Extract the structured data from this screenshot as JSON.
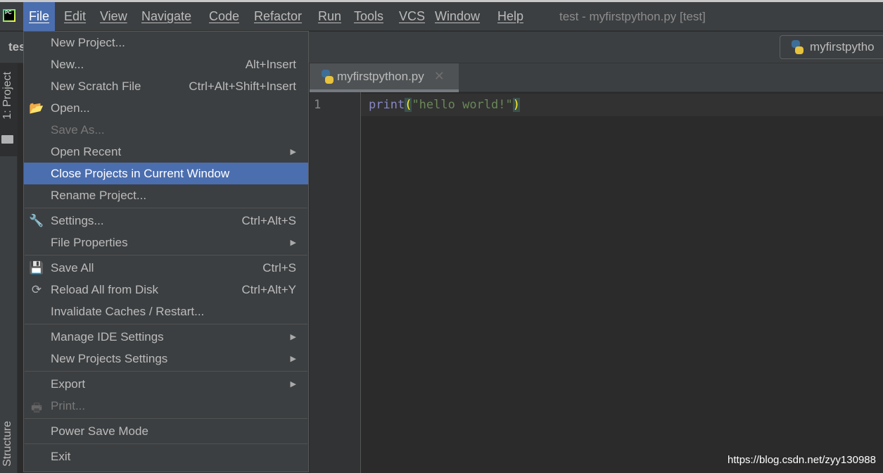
{
  "menubar": {
    "items": [
      "File",
      "Edit",
      "View",
      "Navigate",
      "Code",
      "Refactor",
      "Run",
      "Tools",
      "VCS",
      "Window",
      "Help"
    ],
    "active": "File"
  },
  "window_title": "test - myfirstpython.py [test]",
  "toolbar": {
    "project_name": "tes",
    "run_config": "myfirstpytho"
  },
  "left_panel": {
    "project_tab": "1: Project",
    "structure_tab": "Structure"
  },
  "editor": {
    "tab": "myfirstpython.py",
    "line_number": "1",
    "code": {
      "func": "print",
      "open": "(",
      "string": "\"hello world!\"",
      "close": ")"
    }
  },
  "watermark": "https://blog.csdn.net/zyy130988",
  "file_menu": {
    "new_project": "New Project...",
    "new": "New...",
    "new_sc": "Alt+Insert",
    "scratch": "New Scratch File",
    "scratch_sc": "Ctrl+Alt+Shift+Insert",
    "open": "Open...",
    "save_as": "Save As...",
    "open_recent": "Open Recent",
    "close_projects": "Close Projects in Current Window",
    "rename": "Rename Project...",
    "settings": "Settings...",
    "settings_sc": "Ctrl+Alt+S",
    "file_props": "File Properties",
    "save_all": "Save All",
    "save_all_sc": "Ctrl+S",
    "reload": "Reload All from Disk",
    "reload_sc": "Ctrl+Alt+Y",
    "invalidate": "Invalidate Caches / Restart...",
    "manage_ide": "Manage IDE Settings",
    "new_proj_settings": "New Projects Settings",
    "export": "Export",
    "print": "Print...",
    "power_save": "Power Save Mode",
    "exit": "Exit"
  },
  "colors": {
    "accent": "#4b6eaf",
    "background": "#2b2b2b",
    "panel": "#3c3f41"
  }
}
